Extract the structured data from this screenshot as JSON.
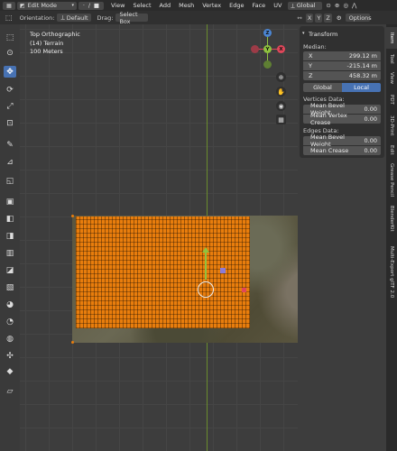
{
  "header": {
    "mode": "Edit Mode",
    "menus": [
      "View",
      "Select",
      "Add",
      "Mesh",
      "Vertex",
      "Edge",
      "Face",
      "UV"
    ],
    "transform_orientation": "Global",
    "axis_buttons": [
      "X",
      "Y",
      "Z"
    ]
  },
  "toolbar": {
    "orientation_label": "Orientation:",
    "orientation_value": "Default",
    "drag_label": "Drag:",
    "drag_value": "Select Box",
    "options_label": "Options"
  },
  "viewport": {
    "view_name": "Top Orthographic",
    "object_name": "(14) Terrain",
    "scale": "100 Meters"
  },
  "gizmo": {
    "x": "X",
    "y": "Y",
    "z": "Z"
  },
  "npanel": {
    "section_title": "Transform",
    "median_label": "Median:",
    "x_label": "X",
    "x_value": "299.12 m",
    "y_label": "Y",
    "y_value": "-215.14 m",
    "z_label": "Z",
    "z_value": "458.32 m",
    "global_label": "Global",
    "local_label": "Local",
    "vertices_title": "Vertices Data:",
    "v_bevel_label": "Mean Bevel Weight",
    "v_bevel_value": "0.00",
    "v_crease_label": "Mean Vertex Crease",
    "v_crease_value": "0.00",
    "edges_title": "Edges Data:",
    "e_bevel_label": "Mean Bevel Weight",
    "e_bevel_value": "0.00",
    "e_crease_label": "Mean Crease",
    "e_crease_value": "0.00"
  },
  "side_tabs": [
    "Item",
    "Tool",
    "View",
    "PDT",
    "3D-Print",
    "Edit",
    "Grease Pencil",
    "BlenderKit",
    "Multi-Export glTF 2.0"
  ],
  "colors": {
    "accent": "#4772b3",
    "selection": "#e87d0d",
    "x_axis": "#e0475a",
    "y_axis": "#8fc23f",
    "z_axis": "#4b86d4"
  }
}
